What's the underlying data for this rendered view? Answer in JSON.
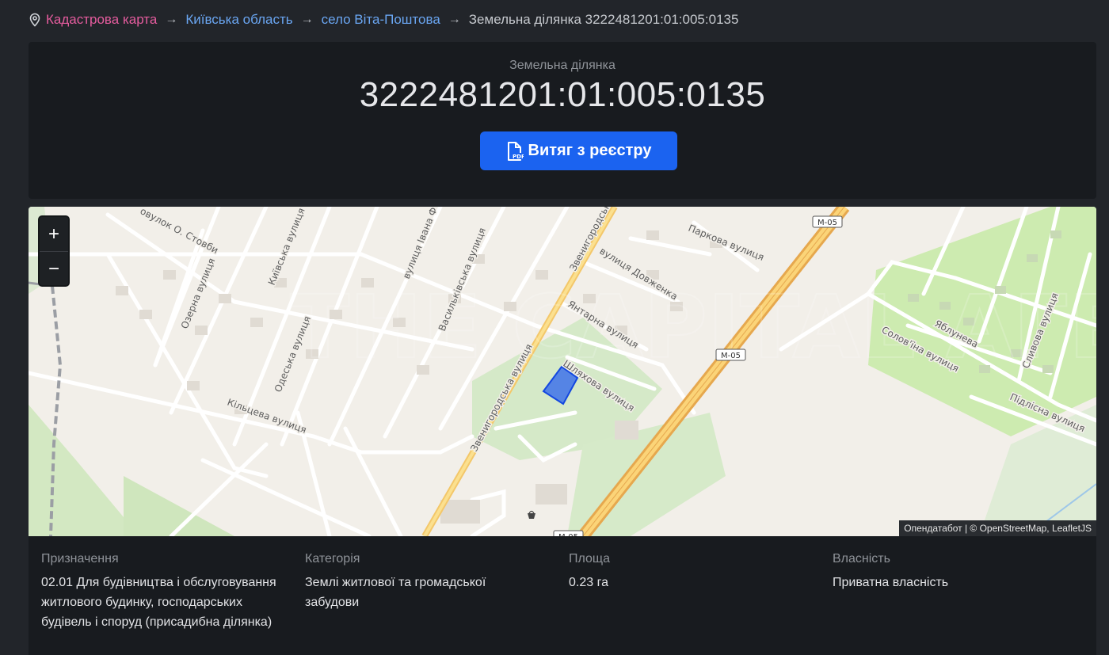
{
  "breadcrumb": {
    "items": [
      "Кадастрова карта",
      "Київська область",
      "село Віта-Поштова"
    ],
    "current": "Земельна ділянка 3222481201:01:005:0135",
    "separator": "→"
  },
  "header": {
    "subtitle": "Земельна ділянка",
    "title": "3222481201:01:005:0135",
    "button_label": "Витяг з реєстру"
  },
  "map": {
    "zoom_in": "+",
    "zoom_out": "−",
    "attribution": "Опендатабот | © OpenStreetMap, LeafletJS",
    "watermark": "THE CAPITAL АГЕНТСТВО НЕРУХОМОСТІ",
    "labels": {
      "provulok": "овулок О. Стовби",
      "kyivska": "Київська вулиця",
      "ozerna": "Озерна вулиця",
      "odeska": "Одеська вулиця",
      "kiltseva": "Кільцева вулиця",
      "ivana": "вулиця Івана Ф",
      "vasylkivska": "Васильківська вулиця",
      "zvenyhorodska": "Звенигородська вулиця",
      "zvenyhorodska2": "Звенигородськ",
      "dovzhenka": "вулиця Довженка",
      "parkova": "Паркова вулиця",
      "yantarna": "Янтарна вулиця",
      "shlyakhova": "Шляхова вулиця",
      "m05": "M-05",
      "solovina": "Солов'їна вулиця",
      "yablunева": "Яблунева",
      "slyvova": "Сливова вулиця",
      "pidlisna": "Підлісна вулиця"
    }
  },
  "info": {
    "purpose_label": "Призначення",
    "purpose_value": "02.01 Для будівництва і обслуговування житлового будинку, господарських будівель і споруд (присадибна ділянка)",
    "category_label": "Категорія",
    "category_value": "Землі житлової та громадської забудови",
    "area_label": "Площа",
    "area_value": "0.23 га",
    "ownership_label": "Власність",
    "ownership_value": "Приватна власність"
  },
  "colors": {
    "accent": "#1b63f0",
    "crumb_pink": "#e55c9e",
    "crumb_blue": "#6aa6f2",
    "parcel": "#2a62ef"
  }
}
